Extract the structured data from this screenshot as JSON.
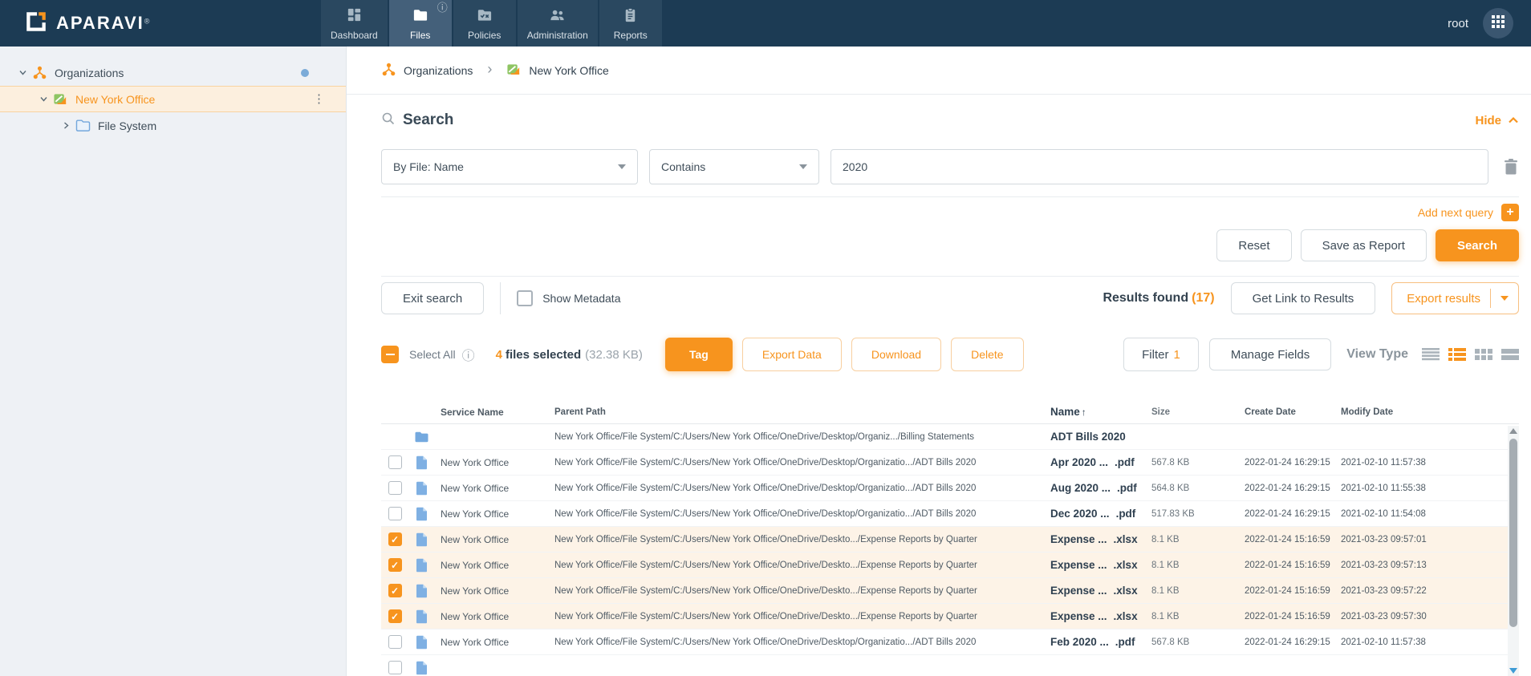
{
  "app": {
    "brand": "APARAVI",
    "brand_reg": "®",
    "user": "root"
  },
  "nav": {
    "tabs": [
      {
        "label": "Dashboard",
        "icon": "dashboard-icon",
        "active": false
      },
      {
        "label": "Files",
        "icon": "files-icon",
        "active": true,
        "badge": "info"
      },
      {
        "label": "Policies",
        "icon": "policies-icon",
        "active": false
      },
      {
        "label": "Administration",
        "icon": "administration-icon",
        "active": false
      },
      {
        "label": "Reports",
        "icon": "reports-icon",
        "active": false
      }
    ]
  },
  "sidebar": {
    "items": [
      {
        "label": "Organizations",
        "icon": "organizations-icon",
        "expanded": true,
        "selected": false,
        "indicator": "blue-dot"
      },
      {
        "label": "New York Office",
        "icon": "office-icon",
        "expanded": true,
        "selected": true,
        "menu": "kebab-menu"
      },
      {
        "label": "File System",
        "icon": "folder-icon",
        "expanded": false,
        "selected": false
      }
    ]
  },
  "breadcrumb": {
    "items": [
      {
        "label": "Organizations"
      },
      {
        "label": "New York Office"
      }
    ]
  },
  "search": {
    "title": "Search",
    "hide_label": "Hide",
    "fields": {
      "field": "By File: Name",
      "operator": "Contains",
      "value": "2020"
    },
    "add_next_query": "Add next query",
    "buttons": {
      "reset": "Reset",
      "save_as_report": "Save as Report",
      "search": "Search"
    }
  },
  "results_bar": {
    "exit_search": "Exit search",
    "show_metadata": "Show Metadata",
    "show_metadata_checked": false,
    "results_found_label": "Results found",
    "results_count": "(17)",
    "get_link": "Get Link to Results",
    "export_results": "Export results"
  },
  "selection_bar": {
    "select_all": "Select All",
    "selected_count": "4",
    "selected_label": "files selected",
    "selected_size": "(32.38 KB)",
    "buttons": {
      "tag": "Tag",
      "export_data": "Export Data",
      "download": "Download",
      "delete": "Delete"
    },
    "filter_label": "Filter",
    "filter_count": "1",
    "manage_fields": "Manage Fields",
    "view_type_label": "View Type",
    "view_active": "detail-list"
  },
  "table": {
    "columns": {
      "service": "Service Name",
      "path": "Parent Path",
      "name": "Name",
      "size": "Size",
      "create": "Create Date",
      "modify": "Modify Date"
    },
    "sort": {
      "column": "Name",
      "direction": "asc",
      "arrow": "↑"
    },
    "rows": [
      {
        "type": "folder",
        "checkbox": null,
        "selected": false,
        "service": "",
        "path": "New York Office/File System/C:/Users/New York Office/OneDrive/Desktop/Organiz.../Billing Statements",
        "name": "ADT Bills 2020",
        "ext": "",
        "size": "",
        "create": "",
        "modify": ""
      },
      {
        "type": "file",
        "checkbox": false,
        "selected": false,
        "service": "New York Office",
        "path": "New York Office/File System/C:/Users/New York Office/OneDrive/Desktop/Organizatio.../ADT Bills 2020",
        "name": "Apr 2020 ...",
        "ext": ".pdf",
        "size": "567.8 KB",
        "create": "2022-01-24 16:29:15",
        "modify": "2021-02-10 11:57:38"
      },
      {
        "type": "file",
        "checkbox": false,
        "selected": false,
        "service": "New York Office",
        "path": "New York Office/File System/C:/Users/New York Office/OneDrive/Desktop/Organizatio.../ADT Bills 2020",
        "name": "Aug 2020 ...",
        "ext": ".pdf",
        "size": "564.8 KB",
        "create": "2022-01-24 16:29:15",
        "modify": "2021-02-10 11:55:38"
      },
      {
        "type": "file",
        "checkbox": false,
        "selected": false,
        "service": "New York Office",
        "path": "New York Office/File System/C:/Users/New York Office/OneDrive/Desktop/Organizatio.../ADT Bills 2020",
        "name": "Dec 2020 ...",
        "ext": ".pdf",
        "size": "517.83 KB",
        "create": "2022-01-24 16:29:15",
        "modify": "2021-02-10 11:54:08"
      },
      {
        "type": "file",
        "checkbox": true,
        "selected": true,
        "service": "New York Office",
        "path": "New York Office/File System/C:/Users/New York Office/OneDrive/Deskto.../Expense Reports by Quarter",
        "name": "Expense ...",
        "ext": ".xlsx",
        "size": "8.1 KB",
        "create": "2022-01-24 15:16:59",
        "modify": "2021-03-23 09:57:01"
      },
      {
        "type": "file",
        "checkbox": true,
        "selected": true,
        "service": "New York Office",
        "path": "New York Office/File System/C:/Users/New York Office/OneDrive/Deskto.../Expense Reports by Quarter",
        "name": "Expense ...",
        "ext": ".xlsx",
        "size": "8.1 KB",
        "create": "2022-01-24 15:16:59",
        "modify": "2021-03-23 09:57:13"
      },
      {
        "type": "file",
        "checkbox": true,
        "selected": true,
        "service": "New York Office",
        "path": "New York Office/File System/C:/Users/New York Office/OneDrive/Deskto.../Expense Reports by Quarter",
        "name": "Expense ...",
        "ext": ".xlsx",
        "size": "8.1 KB",
        "create": "2022-01-24 15:16:59",
        "modify": "2021-03-23 09:57:22"
      },
      {
        "type": "file",
        "checkbox": true,
        "selected": true,
        "service": "New York Office",
        "path": "New York Office/File System/C:/Users/New York Office/OneDrive/Deskto.../Expense Reports by Quarter",
        "name": "Expense ...",
        "ext": ".xlsx",
        "size": "8.1 KB",
        "create": "2022-01-24 15:16:59",
        "modify": "2021-03-23 09:57:30"
      },
      {
        "type": "file",
        "checkbox": false,
        "selected": false,
        "service": "New York Office",
        "path": "New York Office/File System/C:/Users/New York Office/OneDrive/Desktop/Organizatio.../ADT Bills 2020",
        "name": "Feb 2020 ...",
        "ext": ".pdf",
        "size": "567.8 KB",
        "create": "2022-01-24 16:29:15",
        "modify": "2021-02-10 11:57:38"
      },
      {
        "type": "file",
        "checkbox": false,
        "selected": false,
        "partial": true,
        "service": "",
        "path": "",
        "name": "",
        "ext": "",
        "size": "",
        "create": "",
        "modify": ""
      }
    ]
  },
  "colors": {
    "accent_orange": "#f7941e",
    "nav_bg": "#1c3b54",
    "nav_tab_bg": "#2a4860",
    "nav_tab_active_bg": "#44607a",
    "sidebar_bg": "#eef1f5",
    "sidebar_selected_bg": "#fcefde",
    "selected_row_bg": "#fdf3e7",
    "blue_indicator": "#7babd8"
  }
}
